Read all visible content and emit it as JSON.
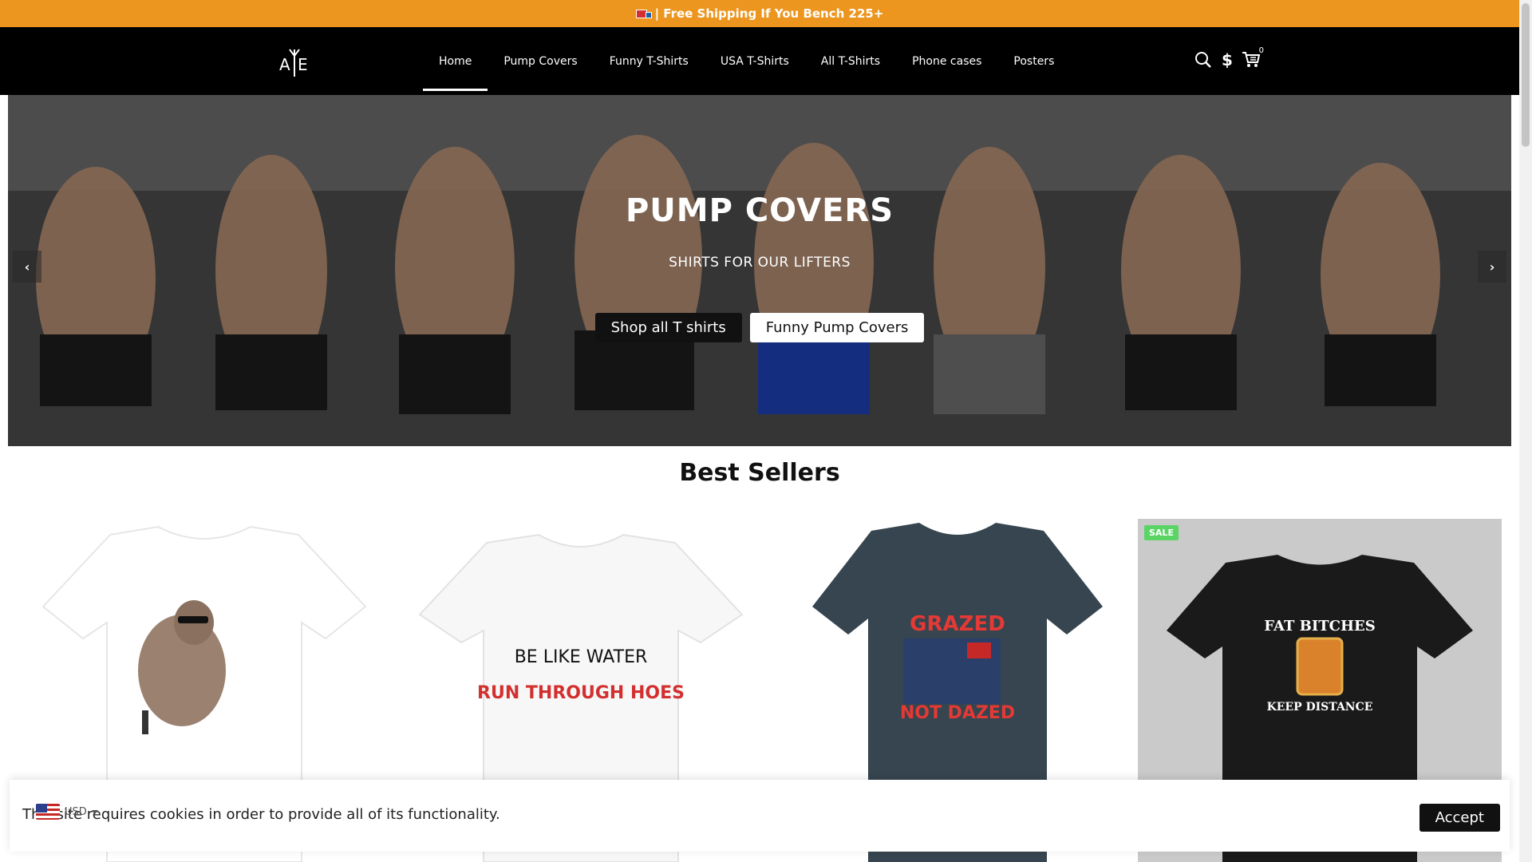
{
  "announcement": {
    "text": "| Free Shipping If You Bench 225+",
    "icon": "truck-icon"
  },
  "header": {
    "logo_text": "A E",
    "nav": [
      {
        "label": "Home",
        "active": true
      },
      {
        "label": "Pump Covers"
      },
      {
        "label": "Funny T-Shirts"
      },
      {
        "label": "USA T-Shirts"
      },
      {
        "label": "All T-Shirts"
      },
      {
        "label": "Phone cases"
      },
      {
        "label": "Posters"
      }
    ],
    "icons": [
      "search-icon",
      "currency-icon",
      "cart-icon"
    ],
    "cart_count": "0"
  },
  "hero": {
    "title": "PUMP COVERS",
    "subtitle": "SHIRTS FOR OUR LIFTERS",
    "btn_primary": "Shop all T shirts",
    "btn_secondary": "Funny Pump Covers",
    "prev_icon": "chevron-left-icon",
    "next_icon": "chevron-right-icon"
  },
  "best_sellers": {
    "title": "Best Sellers",
    "products": [
      {
        "shirt_color": "#ffffff",
        "print_top": "",
        "print_bottom": "",
        "badge": ""
      },
      {
        "shirt_color": "#f7f7f7",
        "print_top": "BE LIKE WATER",
        "print_bottom": "RUN THROUGH HOES",
        "badge": ""
      },
      {
        "shirt_color": "#36454f",
        "print_top": "GRAZED",
        "print_bottom": "NOT DAZED",
        "badge": ""
      },
      {
        "shirt_color": "#1a1a1a",
        "print_top": "FAT BITCHES",
        "print_bottom": "KEEP DISTANCE",
        "badge": "SALE"
      }
    ]
  },
  "cookie": {
    "text": "This site requires cookies in order to provide all of its functionality.",
    "accept": "Accept"
  },
  "currency": {
    "code": "USD"
  },
  "colors": {
    "announce_bg": "#ec961f",
    "header_bg": "#000000",
    "sale_badge": "#5bd466"
  }
}
